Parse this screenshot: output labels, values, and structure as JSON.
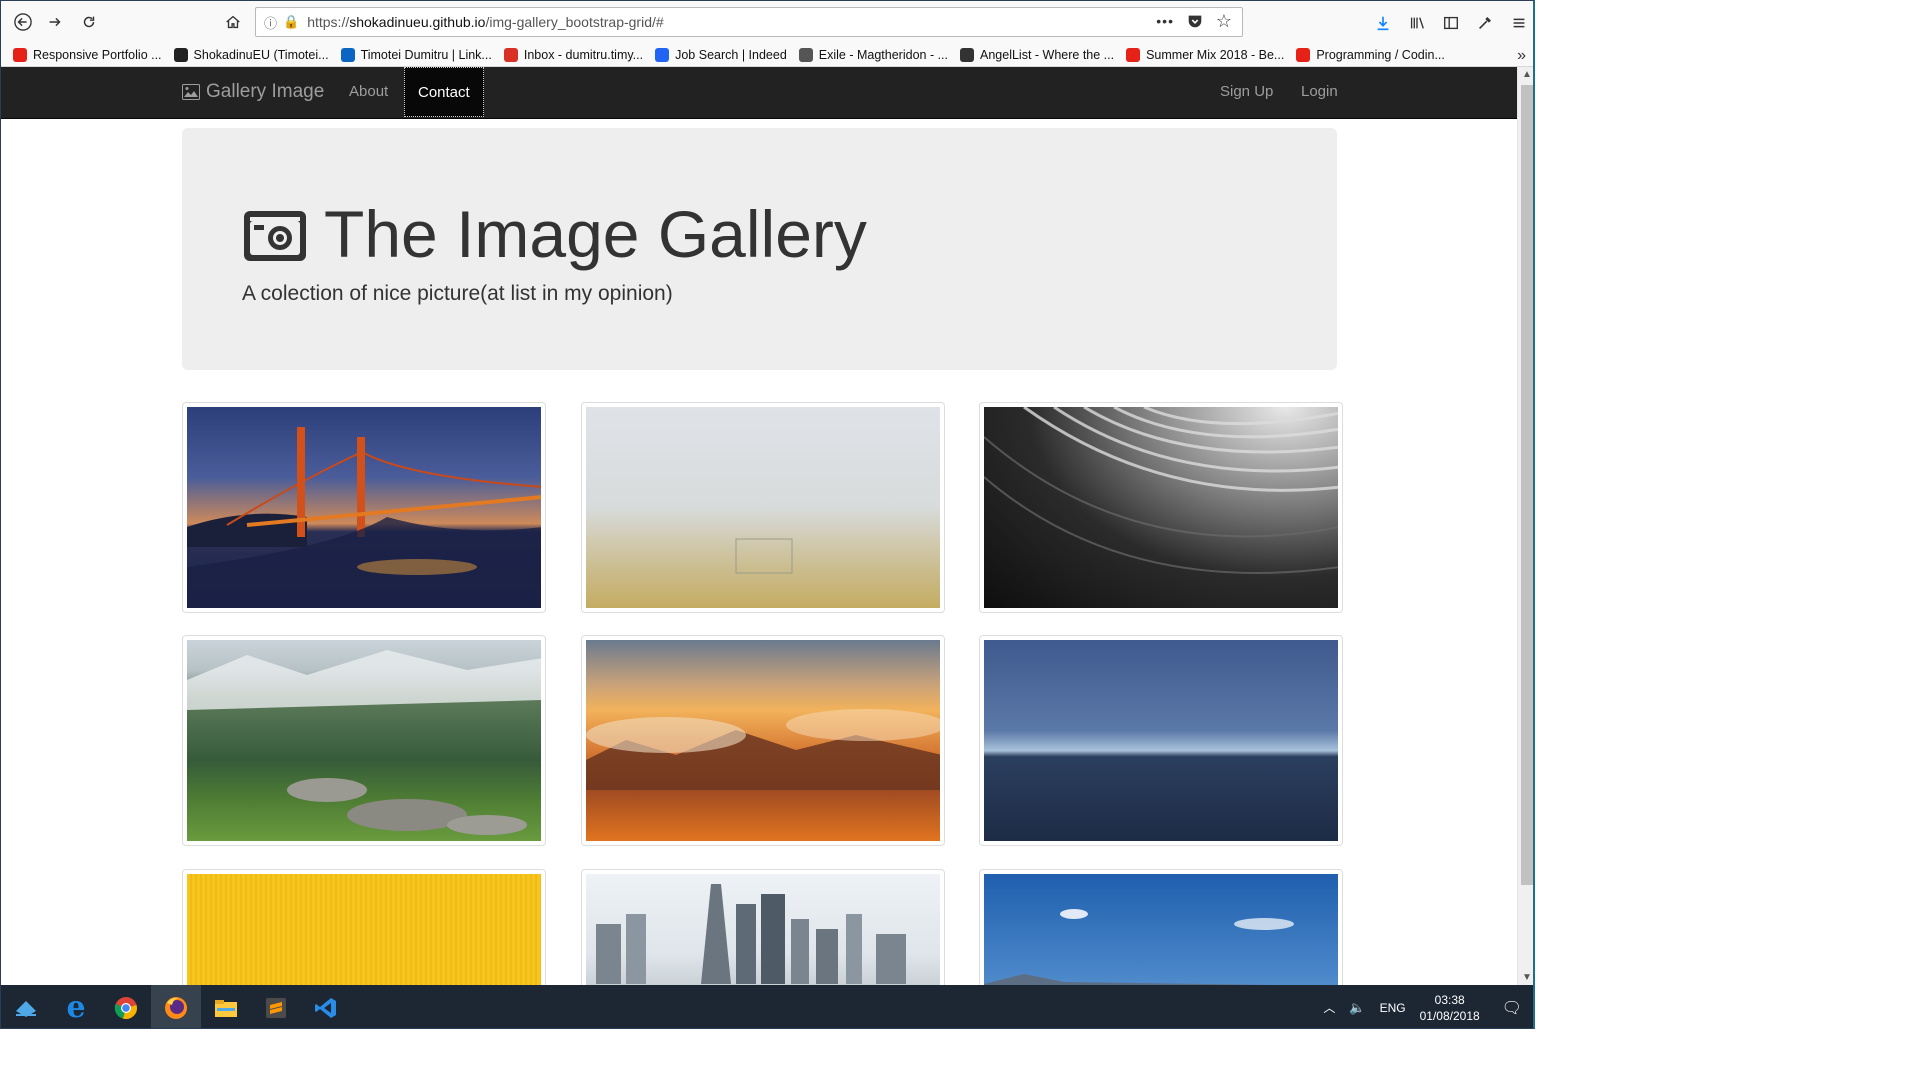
{
  "browser": {
    "url_prefix": "https://",
    "url_host": "shokadinueu.github.io",
    "url_path": "/img-gallery_bootstrap-grid/#",
    "bookmarks": [
      {
        "label": "Responsive Portfolio ...",
        "icon": "youtube-icon",
        "color": "#e62117"
      },
      {
        "label": "ShokadinuEU (Timotei...",
        "icon": "github-icon",
        "color": "#222222"
      },
      {
        "label": "Timotei Dumitru | Link...",
        "icon": "linkedin-icon",
        "color": "#0a66c2"
      },
      {
        "label": "Inbox - dumitru.timy...",
        "icon": "gmail-icon",
        "color": "#d93025"
      },
      {
        "label": "Job Search | Indeed",
        "icon": "indeed-icon",
        "color": "#2164f3"
      },
      {
        "label": "Exile - Magtheridon - ...",
        "icon": "globe-icon",
        "color": "#555555"
      },
      {
        "label": "AngelList - Where the ...",
        "icon": "angellist-icon",
        "color": "#333333"
      },
      {
        "label": "Summer Mix 2018 - Be...",
        "icon": "youtube-icon",
        "color": "#e62117"
      },
      {
        "label": "Programming / Codin...",
        "icon": "youtube-icon",
        "color": "#e62117"
      }
    ]
  },
  "site": {
    "brand": "Gallery Image",
    "nav_left": [
      "About",
      "Contact"
    ],
    "active_nav": "Contact",
    "nav_right": [
      "Sign Up",
      "Login"
    ],
    "jumbotron": {
      "title": "The Image Gallery",
      "subtitle": "A colection of nice picture(at list in my opinion)"
    },
    "thumbnails": [
      {
        "subject": "golden-gate-bridge-night"
      },
      {
        "subject": "foggy-field"
      },
      {
        "subject": "abstract-architecture-bw"
      },
      {
        "subject": "mountain-meadow"
      },
      {
        "subject": "sunset-clouds-mountains"
      },
      {
        "subject": "ocean-horizon-blue"
      },
      {
        "subject": "yellow-texture"
      },
      {
        "subject": "city-skyline"
      },
      {
        "subject": "blue-sky-clouds"
      }
    ]
  },
  "taskbar": {
    "apps": [
      "windows-start-icon",
      "edge-icon",
      "chrome-icon",
      "firefox-icon",
      "file-explorer-icon",
      "sublime-text-icon",
      "vscode-icon"
    ],
    "language": "ENG",
    "time": "03:38",
    "date": "01/08/2018"
  },
  "colors": {
    "navbar_bg": "#222222",
    "jumbotron_bg": "#eeeeee",
    "taskbar_bg": "#1c2733"
  }
}
